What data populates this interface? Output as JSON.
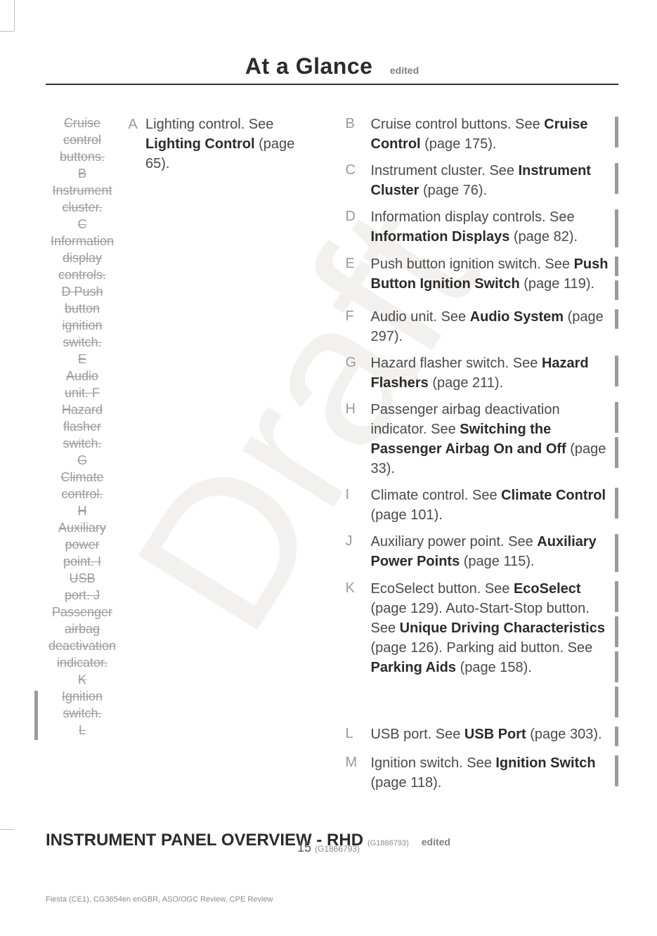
{
  "header": {
    "title": "At a Glance",
    "badge": "edited"
  },
  "watermark": "Draft",
  "left": {
    "A": {
      "label": "A",
      "text": "Lighting control. See ",
      "bold": "Lighting Control",
      "tail": " (page 65)."
    },
    "strike_lines": [
      "Cruise",
      "control",
      "buttons.",
      "B",
      "Instrument",
      "cluster.",
      "C",
      "Information",
      "display",
      "controls.",
      "D  Push",
      "button",
      "ignition",
      "switch.",
      "E",
      "Audio",
      "unit.  F",
      "Hazard",
      "flasher",
      "switch.",
      "G",
      "Climate",
      "control.",
      "H",
      "Auxiliary",
      "power",
      "point.  I",
      "USB",
      "port.  J",
      "Passenger",
      "airbag",
      "deactivation",
      "indicator.",
      "K",
      "Ignition",
      "switch.",
      "L"
    ]
  },
  "right": [
    {
      "label": "B",
      "runs": [
        [
          "",
          "Cruise control buttons.  See "
        ],
        [
          "b",
          "Cruise Control"
        ],
        [
          "",
          " (page 175)."
        ]
      ],
      "bars": [
        "h1"
      ]
    },
    {
      "label": "C",
      "runs": [
        [
          "",
          "Instrument cluster.  See "
        ],
        [
          "b",
          "Instrument Cluster"
        ],
        [
          "",
          " (page 76)."
        ]
      ],
      "bars": [
        "h1"
      ]
    },
    {
      "label": "D",
      "runs": [
        [
          "",
          "Information display controls.  See "
        ],
        [
          "b",
          "Information Displays"
        ],
        [
          "",
          " (page 82)."
        ]
      ],
      "bars": [
        "h2"
      ]
    },
    {
      "label": "E",
      "runs": [
        [
          "",
          "Push button ignition switch.  See "
        ],
        [
          "b",
          "Push Button Ignition Switch"
        ],
        [
          "",
          " (page 119)."
        ]
      ],
      "bars": [
        "h3",
        "h3"
      ]
    },
    {
      "label": "F",
      "runs": [
        [
          "",
          "Audio unit.  See "
        ],
        [
          "b",
          "Audio System"
        ],
        [
          "",
          " (page 297)."
        ]
      ],
      "bars": [
        "h3"
      ]
    },
    {
      "label": "G",
      "runs": [
        [
          "",
          "Hazard flasher switch.  See "
        ],
        [
          "b",
          "Hazard Flashers"
        ],
        [
          "",
          " (page 211)."
        ]
      ],
      "bars": [
        "h1"
      ]
    },
    {
      "label": "H",
      "runs": [
        [
          "",
          "Passenger airbag deactivation indicator.  See "
        ],
        [
          "b",
          "Switching the Passenger Airbag On and Off"
        ],
        [
          "",
          " (page 33)."
        ]
      ],
      "bars": [
        "h1",
        "h1"
      ]
    },
    {
      "label": "I",
      "runs": [
        [
          "",
          "Climate control.  See "
        ],
        [
          "b",
          "Climate Control"
        ],
        [
          "",
          " (page 101)."
        ]
      ],
      "bars": [
        "h1"
      ]
    },
    {
      "label": "J",
      "runs": [
        [
          "",
          "Auxiliary power point.  See "
        ],
        [
          "b",
          "Auxiliary Power Points"
        ],
        [
          "",
          " (page 115)."
        ]
      ],
      "bars": [
        "h2"
      ]
    },
    {
      "label": "K",
      "runs": [
        [
          "",
          "EcoSelect button.  See "
        ],
        [
          "b",
          "EcoSelect"
        ],
        [
          "",
          " (page 129).  Auto-Start-Stop button.  See "
        ],
        [
          "b",
          "Unique Driving Characteristics"
        ],
        [
          "",
          " (page 126).  Parking aid button.  See "
        ],
        [
          "b",
          "Parking Aids"
        ],
        [
          "",
          " (page 158)."
        ]
      ],
      "bars": [
        "h1",
        "h1",
        "h1",
        "h1"
      ]
    },
    {
      "label": "L",
      "runs": [
        [
          "",
          "USB port.  See "
        ],
        [
          "b",
          "USB Port"
        ],
        [
          "",
          " (page 303)."
        ]
      ],
      "bars": [
        "h3"
      ]
    },
    {
      "label": "M",
      "runs": [
        [
          "",
          "Ignition switch.  See "
        ],
        [
          "b",
          "Ignition Switch"
        ],
        [
          "",
          " (page 118)."
        ]
      ],
      "bars": [
        "h1"
      ]
    }
  ],
  "section": {
    "title": "INSTRUMENT PANEL OVERVIEW - RHD",
    "code": "(G1866793)",
    "badge": "edited"
  },
  "footer": {
    "page": "15",
    "code": "(G1866793)",
    "meta": "Fiesta (CE1), CG3654en enGBR, ASO/OGC Review, CPE Review"
  }
}
